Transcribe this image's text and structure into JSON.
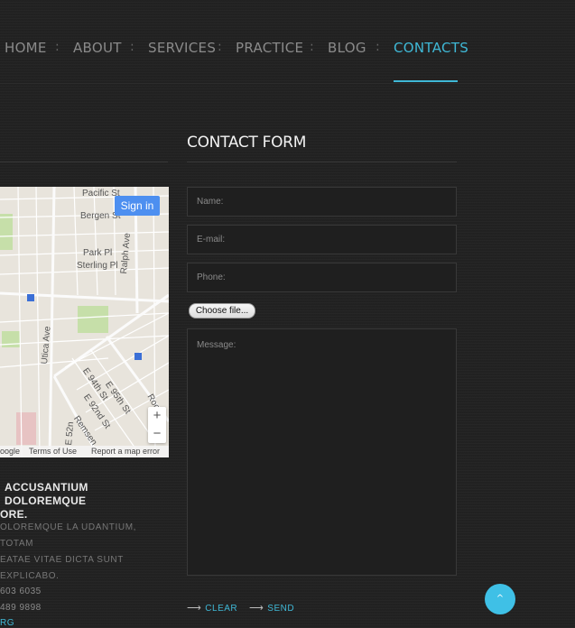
{
  "nav": {
    "items": [
      {
        "label": "HOME"
      },
      {
        "label": "ABOUT"
      },
      {
        "label": "SERVICES"
      },
      {
        "label": "PRACTICE"
      },
      {
        "label": "BLOG"
      },
      {
        "label": "CONTACTS",
        "active": true
      }
    ],
    "separator": ":"
  },
  "map": {
    "signin_label": "Sign in",
    "zoom_in": "+",
    "zoom_out": "−",
    "labels": {
      "pacific": "Pacific St",
      "bergen": "Bergen St",
      "park": "Park Pl",
      "sterling": "Sterling Pl",
      "ralph": "Ralph Ave",
      "utica": "Utica Ave",
      "e94": "E 94th St",
      "e95": "E 95th St",
      "e92": "E 92nd St",
      "remsen": "Remsen",
      "rock": "Rock",
      "e52": "E 52n"
    },
    "footer": {
      "google": "oogle",
      "terms": "Terms of Use",
      "report": "Report a map error"
    }
  },
  "left": {
    "heading": "ACCUSANTIUM DOLOREMQUE ...ORE.",
    "heading_line1": "ACCUSANTIUM DOLOREMQUE",
    "heading_line2": "ORE.",
    "text_line1": "OLOREMQUE LA UDANTIUM, TOTAM",
    "text_line2": "EATAE VITAE DICTA SUNT EXPLICABO.",
    "phone1": "603 6035",
    "phone2": "489 9898",
    "link": "RG"
  },
  "form": {
    "title": "CONTACT FORM",
    "name_placeholder": "Name:",
    "email_placeholder": "E-mail:",
    "phone_placeholder": "Phone:",
    "file_button": "Choose file...",
    "message_placeholder": "Message:",
    "clear_label": "CLEAR",
    "send_label": "SEND",
    "arrow": "⟶"
  },
  "scroll_top": {
    "icon": "chevron-up-icon",
    "glyph": "^"
  },
  "colors": {
    "accent": "#3fb8d6",
    "background": "#222222"
  }
}
